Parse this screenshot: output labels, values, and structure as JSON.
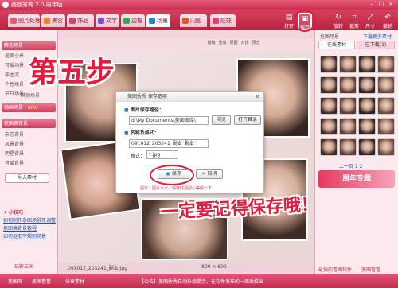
{
  "window": {
    "title": "美图秀秀 2.0 周年版"
  },
  "tabs": [
    {
      "label": "图片处理",
      "color": "#e25a7a"
    },
    {
      "label": "美容",
      "color": "#e08a2a"
    },
    {
      "label": "饰品",
      "color": "#d44070"
    },
    {
      "label": "文字",
      "color": "#7a53c8"
    },
    {
      "label": "边框",
      "color": "#3aa35a"
    },
    {
      "label": "场景",
      "color": "#2f82c8"
    },
    {
      "label": "闪图",
      "color": "#e2552a"
    },
    {
      "label": "娃娃",
      "color": "#e0407a"
    }
  ],
  "toolbar": {
    "open": "打开",
    "save": "保存",
    "rotate": "旋转",
    "crop": "裁剪",
    "size": "尺寸",
    "undo": "撤销"
  },
  "canvas_toolbar": [
    "撤销",
    "重做",
    "原图",
    "对比",
    "预览"
  ],
  "left_panel": {
    "group1_header": "静态场景",
    "group1_items": [
      "逼美小景",
      "可爱场景",
      "非主流",
      "个性场景",
      "节日场景",
      "其他场景"
    ],
    "group2_header": "动画场景",
    "group2_badge": "NEW",
    "group3_header": "抠图换背景",
    "group3_items": [
      "杂志背景",
      "风景背景",
      "明星背景",
      "可爱背景"
    ],
    "import_label": "导入素材",
    "tips_title": "小技巧",
    "tips": [
      "如何制作杂图场景及调整",
      "抠图换背景教程",
      "如何抠取不规则场景"
    ],
    "fun_label": "玩转三国"
  },
  "right_panel": {
    "title": "抠图场景",
    "download_link": "下载更多素材",
    "tab_online": "在线素材",
    "tab_local": "已下载(1)",
    "pager": "上一页 1 2",
    "promo": "周年专题",
    "bottom_text": "最快的看图软件——美图看看"
  },
  "status": {
    "filename": "091012_203241_副本.jpg",
    "dimensions": "800 × 600"
  },
  "dialog": {
    "title": "美图秀秀 保存选项",
    "path_label": "图片保存路径：",
    "path_value": "d:\\My Documents\\美图图库\\",
    "browse_button": "浏览",
    "open_dir_button": "打开目录",
    "name_label": "名称及格式：",
    "name_value": "091012_203241_副本_副本",
    "format_label": "格式：",
    "format_value": "*.jpg",
    "save_button": "保存",
    "cancel_button": "取消",
    "tip": "提示：图片太大，保存时请耐心等候一下"
  },
  "overlay": {
    "step": "第五步",
    "reminder": "一定要记得保存哦！"
  },
  "footer": {
    "items": [
      "美图网",
      "美图看看",
      "分享素材"
    ],
    "news": "【公告】美图秀秀自动升级提示，在软件发布的一周后推出"
  },
  "colors": {
    "accent": "#e8193c",
    "chrome": "#c8304f",
    "panel": "#fbe9ee"
  }
}
